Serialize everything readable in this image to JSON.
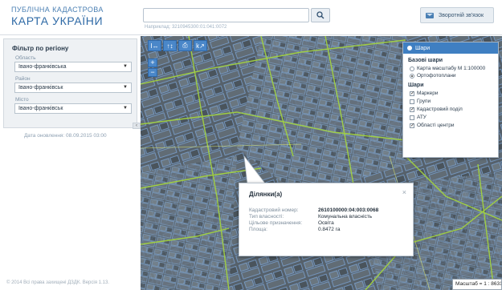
{
  "header": {
    "logo_line1": "ПУБЛІЧНА КАДАСТРОВА",
    "logo_line2": "КАРТА УКРАЇНИ",
    "search_value": "",
    "search_hint": "Наприклад: 3210945300:01:041:0072",
    "feedback_label": "Зворотній зв'язок",
    "feedback_icon": "mail-icon",
    "search_icon": "search-icon"
  },
  "sidebar": {
    "filter_title": "Фільтр по регіону",
    "oblast_label": "Область",
    "oblast_value": "Івано-франківська",
    "raion_label": "Район",
    "raion_value": "Івано-франківськ",
    "misto_label": "Місто",
    "misto_value": "Івано-франківськ",
    "update_date": "Дата оновлення: 08.09.2015 03:00",
    "copyright": "© 2014 Всі права захищені ДЗДК. Версія 1.13."
  },
  "map": {
    "toolbar": [
      "I↔",
      "↑↕",
      "⎙",
      "k↗"
    ],
    "zoom_in": "+",
    "zoom_out": "−",
    "scale_text": "Масштаб = 1 : 8631",
    "colors": {
      "parcel": "#6f9fd6",
      "road": "#9ccb3b",
      "panel_head": "#3f7fc2"
    }
  },
  "layers": {
    "title": "Шари",
    "base_title": "Базові шари",
    "base": [
      {
        "label": "Карта масштабу М 1:100000",
        "selected": false
      },
      {
        "label": "Ортофотоплани",
        "selected": true
      }
    ],
    "layers_title": "Шари",
    "items": [
      {
        "label": "Маркери",
        "checked": true
      },
      {
        "label": "Групи",
        "checked": false
      },
      {
        "label": "Кадастровий поділ",
        "checked": true
      },
      {
        "label": "АТУ",
        "checked": false
      },
      {
        "label": "Області центри",
        "checked": true
      }
    ]
  },
  "popup": {
    "title": "Ділянки(а)",
    "close": "×",
    "rows": [
      {
        "key": "Кадастровий номер:",
        "value": "2610100000:04:003:0068"
      },
      {
        "key": "Тип власності:",
        "value": "Комунальна власність"
      },
      {
        "key": "Цільове призначення:",
        "value": "Освіта"
      },
      {
        "key": "Площа:",
        "value": "0.8472 га"
      }
    ]
  }
}
